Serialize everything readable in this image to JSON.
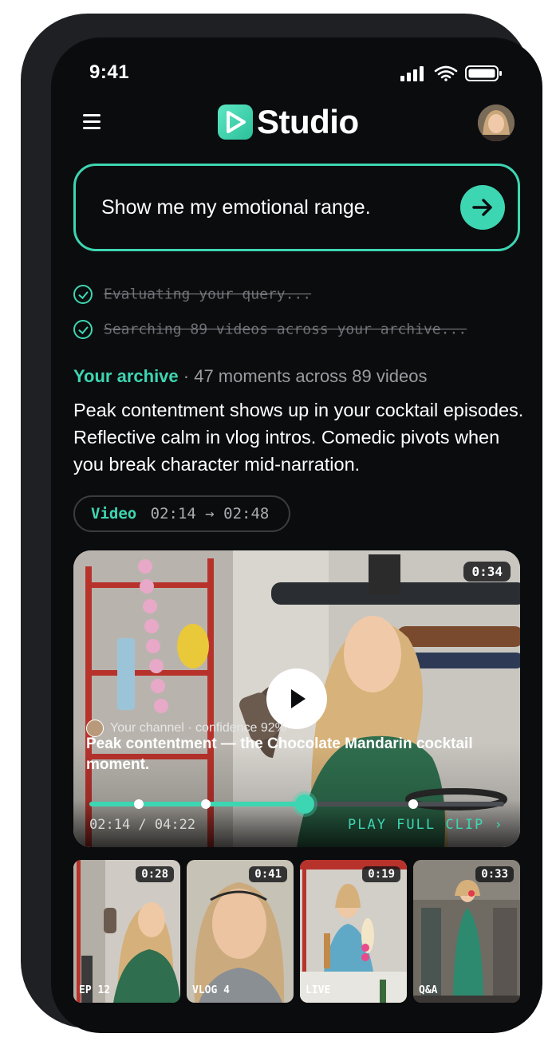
{
  "status_bar": {
    "time": "9:41"
  },
  "header": {
    "brand": "Studio"
  },
  "query": {
    "text": "Show me my emotional range."
  },
  "steps": [
    {
      "label": "Evaluating your query..."
    },
    {
      "label": "Searching 89 videos across your archive..."
    }
  ],
  "archive": {
    "label": "Your archive",
    "stats": "· 47 moments across 89 videos",
    "summary": "Peak contentment shows up in your cocktail episodes. Reflective calm in vlog intros. Comedic pivots when you break character mid-narration."
  },
  "clip_range": {
    "label": "Video",
    "range": "02:14 → 02:48"
  },
  "main_video": {
    "duration": "0:34",
    "meta": "Your channel · confidence 92%",
    "title": "Peak contentment — the Chocolate Mandarin cocktail moment.",
    "position": "02:14 / 04:22",
    "progress": 0.52,
    "markers": [
      0.12,
      0.28,
      0.78
    ],
    "cta": "PLAY FULL CLIP ›"
  },
  "thumbnails": [
    {
      "duration": "0:28",
      "tag": "EP 12"
    },
    {
      "duration": "0:41",
      "tag": "VLOG 4"
    },
    {
      "duration": "0:19",
      "tag": "LIVE"
    },
    {
      "duration": "0:33",
      "tag": "Q&A"
    }
  ],
  "colors": {
    "accent": "#3dd6b2",
    "background": "#0b0c0e",
    "frame": "#1e2024"
  }
}
